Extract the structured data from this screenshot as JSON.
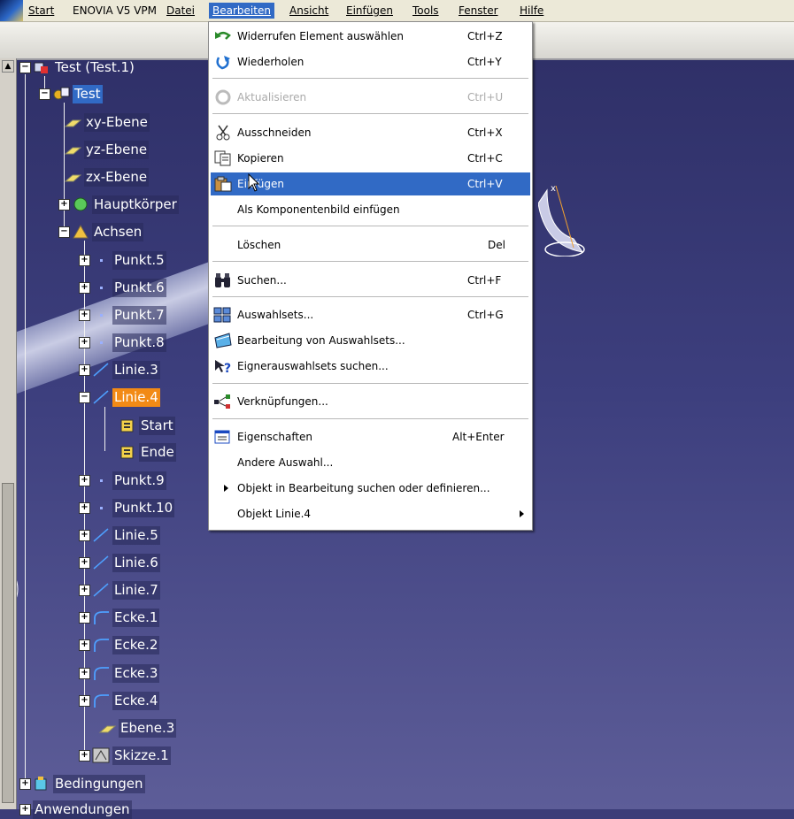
{
  "menubar": {
    "items": [
      "Start",
      "ENOVIA V5 VPM",
      "Datei",
      "Bearbeiten",
      "Ansicht",
      "Einfügen",
      "Tools",
      "Fenster",
      "Hilfe"
    ]
  },
  "tree": {
    "root": "Test (Test.1)",
    "part": "Test",
    "planes": [
      "xy-Ebene",
      "yz-Ebene",
      "zx-Ebene"
    ],
    "body": "Hauptkörper",
    "geoset": "Achsen",
    "points_a": [
      "Punkt.5",
      "Punkt.6",
      "Punkt.7",
      "Punkt.8"
    ],
    "line3": "Linie.3",
    "line4": "Linie.4",
    "line4_children": [
      "Start",
      "Ende"
    ],
    "points_b": [
      "Punkt.9",
      "Punkt.10"
    ],
    "lines": [
      "Linie.5",
      "Linie.6",
      "Linie.7"
    ],
    "corners": [
      "Ecke.1",
      "Ecke.2",
      "Ecke.3",
      "Ecke.4"
    ],
    "plane3": "Ebene.3",
    "sketch": "Skizze.1",
    "constraints": "Bedingungen",
    "applications": "Anwendungen"
  },
  "edit_menu": {
    "undo": {
      "label": "Widerrufen Element auswählen",
      "shortcut": "Ctrl+Z",
      "icon": "undo-icon"
    },
    "redo": {
      "label": "Wiederholen",
      "shortcut": "Ctrl+Y",
      "icon": "redo-icon"
    },
    "update": {
      "label": "Aktualisieren",
      "shortcut": "Ctrl+U",
      "icon": "update-icon"
    },
    "cut": {
      "label": "Ausschneiden",
      "shortcut": "Ctrl+X",
      "icon": "scissors-icon"
    },
    "copy": {
      "label": "Kopieren",
      "shortcut": "Ctrl+C",
      "icon": "copy-icon"
    },
    "paste": {
      "label": "Einfügen",
      "shortcut": "Ctrl+V",
      "icon": "paste-icon"
    },
    "paste_image": {
      "label": "Als Komponentenbild einfügen"
    },
    "delete": {
      "label": "Löschen",
      "shortcut": "Del"
    },
    "search": {
      "label": "Suchen...",
      "shortcut": "Ctrl+F",
      "icon": "binoculars-icon"
    },
    "selection_sets": {
      "label": "Auswahlsets...",
      "shortcut": "Ctrl+G",
      "icon": "selection-sets-icon"
    },
    "edit_selection_sets": {
      "label": "Bearbeitung von Auswahlsets...",
      "icon": "edit-sets-icon"
    },
    "owner_sets": {
      "label": "Eignerauswahlsets suchen...",
      "icon": "owner-search-icon"
    },
    "links": {
      "label": "Verknüpfungen...",
      "icon": "links-icon"
    },
    "properties": {
      "label": "Eigenschaften",
      "shortcut": "Alt+Enter",
      "icon": "properties-icon"
    },
    "other_selection": {
      "label": "Andere Auswahl..."
    },
    "find_object": {
      "label": "Objekt in Bearbeitung suchen oder definieren..."
    },
    "object_submenu": {
      "label": "Objekt Linie.4"
    }
  },
  "colors": {
    "highlight": "#316ac5",
    "selected_orange": "#f28a16",
    "viewport": "#3d3f7e"
  }
}
